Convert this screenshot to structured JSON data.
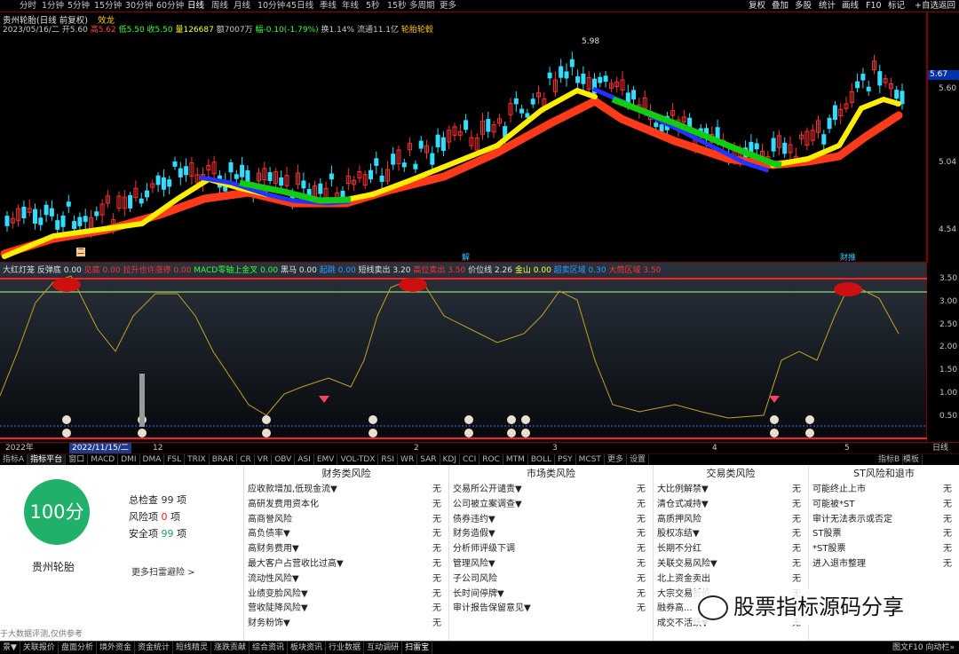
{
  "periods": [
    "分时",
    "1分钟",
    "5分钟",
    "15分钟",
    "30分钟",
    "60分钟",
    "日线",
    "周线",
    "月线",
    "10分钟",
    "45日线",
    "季线",
    "年线",
    "5秒",
    "15秒",
    "多周期",
    "更多"
  ],
  "selected_period": "日线",
  "toolbar": [
    "复权",
    "叠加",
    "多股",
    "统计",
    "画线",
    "F10",
    "标记",
    "+自选",
    "返回"
  ],
  "stock": {
    "title": "贵州轮胎(日线 前复权)",
    "indicator": "效龙",
    "date": "2023/05/16/二",
    "open": "开5.60",
    "high": "高5.62",
    "low": "低5.50",
    "close": "收5.50",
    "volume": "量126687",
    "amount": "额7007万",
    "change": "幅-0.10(-1.79%)",
    "turnover": "换1.14%",
    "float": "流通11.1亿",
    "concept": "轮胎轮毂"
  },
  "price_axis": {
    "labels": [
      "5.60",
      "5.04",
      "4.54"
    ],
    "highlight": "5.67",
    "peak_label": "5.98"
  },
  "chart_markers": {
    "left": "二",
    "mid": "解",
    "right": "财推"
  },
  "indicator_line": {
    "items": [
      [
        "大红灯笼",
        "#e0e0e0"
      ],
      [
        "反弹底",
        "#e0e0e0"
      ],
      [
        "0.00",
        "#e0e0e0"
      ],
      [
        "见底",
        "#ff3333"
      ],
      [
        "0.00",
        "#ff3333"
      ],
      [
        "拉升也许涨停",
        "#ff3333"
      ],
      [
        "0.00",
        "#ff3333"
      ],
      [
        "MACD零轴上金叉",
        "#33ff33"
      ],
      [
        "0.00",
        "#33ff33"
      ],
      [
        "黑马",
        "#e0e0e0"
      ],
      [
        "0.00",
        "#e0e0e0"
      ],
      [
        "起跳",
        "#3399ff"
      ],
      [
        "0.00",
        "#3399ff"
      ],
      [
        "短线卖出",
        "#e0e0e0"
      ],
      [
        "3.20",
        "#e0e0e0"
      ],
      [
        "高位卖出",
        "#ff3333"
      ],
      [
        "3.50",
        "#ff3333"
      ],
      [
        "价位线",
        "#e0e0e0"
      ],
      [
        "2.26",
        "#e0e0e0"
      ],
      [
        "金山",
        "#ffff33"
      ],
      [
        "0.00",
        "#ffff33"
      ],
      [
        "超卖区域",
        "#3399ff"
      ],
      [
        "0.30",
        "#3399ff"
      ],
      [
        "大筒区域",
        "#ff3333"
      ],
      [
        "3.50",
        "#ff3333"
      ]
    ]
  },
  "ind_axis": [
    "3.50",
    "3.00",
    "2.50",
    "2.00",
    "1.50",
    "1.00",
    "0.50"
  ],
  "dates": {
    "year": "2022年",
    "cursor": "2022/11/15/二",
    "ticks": [
      "12",
      "2",
      "3",
      "4",
      "5"
    ],
    "right": "日线"
  },
  "tabs": [
    "指标A",
    "指标平台",
    "窗口",
    "MACD",
    "DMI",
    "DMA",
    "FSL",
    "TRIX",
    "BRAR",
    "CR",
    "VR",
    "OBV",
    "ASI",
    "EMV",
    "VOL-TDX",
    "RSI",
    "WR",
    "SAR",
    "KDJ",
    "CCI",
    "ROC",
    "MTM",
    "BOLL",
    "PSY",
    "MCST",
    "更多",
    "设置"
  ],
  "tabs_right": [
    "指标B",
    "模板"
  ],
  "score": {
    "value": "100分",
    "name": "贵州轮胎",
    "items": [
      {
        "label": "总检查",
        "value": "99",
        "unit": "项"
      },
      {
        "label": "风险项",
        "value": "0",
        "unit": "项"
      },
      {
        "label": "安全项",
        "value": "99",
        "unit": "项"
      }
    ],
    "more": "更多扫雷避险 >",
    "note": "于大数据评测,仅供参考"
  },
  "columns": [
    {
      "title": "财务类风险",
      "rows": [
        "应收款增加,低现金流▼",
        "高研发费用资本化",
        "高商誉风险",
        "高负债率▼",
        "高财务费用▼",
        "最大客户占营收比过高▼",
        "流动性风险▼",
        "业绩变脸风险▼",
        "营收陡降风险▼",
        "财务粉饰▼"
      ]
    },
    {
      "title": "市场类风险",
      "rows": [
        "交易所公开谴责▼",
        "公司被立案调查▼",
        "债券违约▼",
        "财务造假▼",
        "分析师评级下调",
        "管理风险▼",
        "子公司风险",
        "长时间停牌▼",
        "审计报告保留意见▼"
      ]
    },
    {
      "title": "交易类风险",
      "rows": [
        "大比例解禁▼",
        "清仓式减持▼",
        "高质押风险",
        "股权冻结▼",
        "长期不分红",
        "关联交易风险▼",
        "北上资金卖出",
        "大宗交易折价",
        "融券高...",
        "成交不活跃▼"
      ]
    },
    {
      "title": "ST风险和退市",
      "rows": [
        "可能终止上市",
        "可能被*ST",
        "审计无法表示或否定",
        "ST股票",
        "*ST股票",
        "进入退市整理"
      ]
    }
  ],
  "value_none": "无",
  "watermark": "股票指标源码分享",
  "status": [
    "景▼",
    "关联报价",
    "盘面分析",
    "境外资金",
    "资金统计",
    "短线精灵",
    "涨跌贡献",
    "综合资讯",
    "板块资讯",
    "行业数据",
    "互动调研",
    "扫雷宝"
  ],
  "status_right": "图文F10 向动栏»"
}
